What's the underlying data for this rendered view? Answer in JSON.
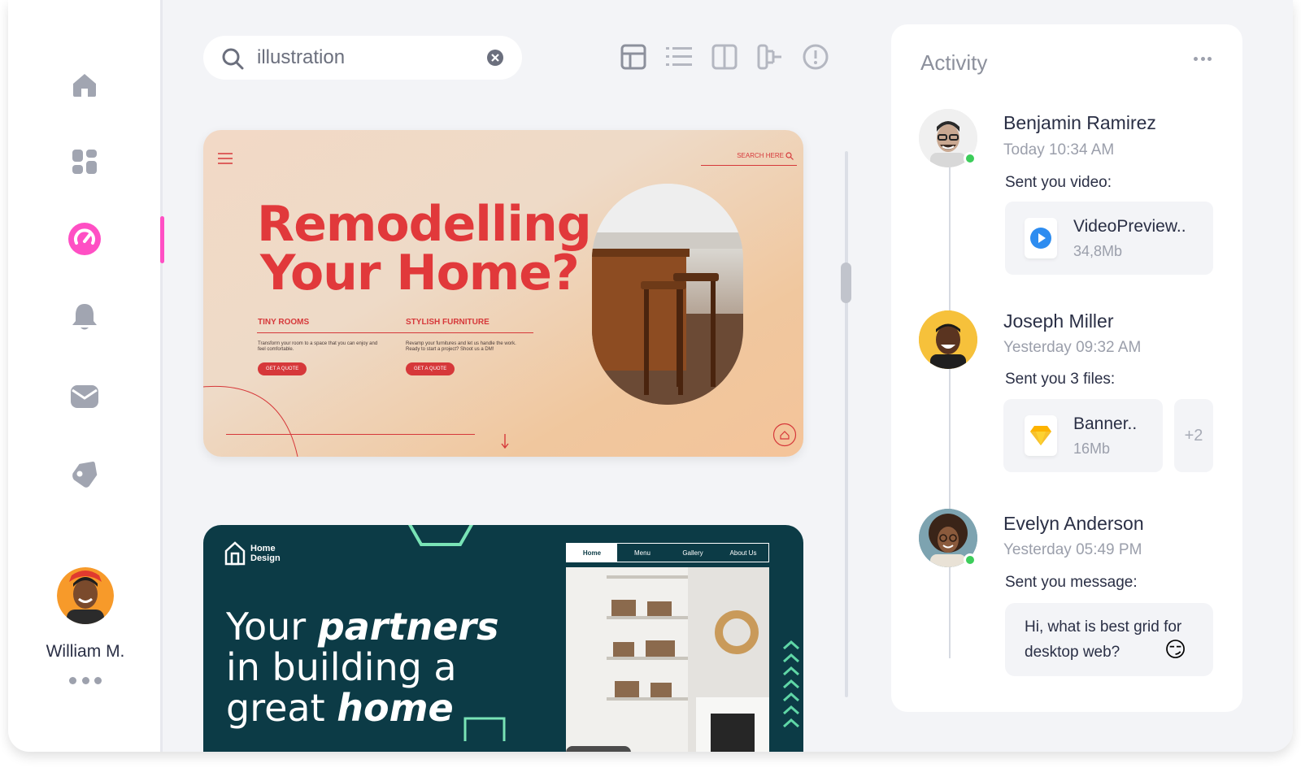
{
  "sidebar": {
    "items": [
      {
        "name": "home-icon"
      },
      {
        "name": "dashboard-icon"
      },
      {
        "name": "speed-gauge-icon",
        "active": true
      },
      {
        "name": "bell-icon"
      },
      {
        "name": "mail-icon"
      },
      {
        "name": "tag-icon"
      }
    ],
    "user": {
      "name": "William M."
    }
  },
  "search": {
    "value": "illustration"
  },
  "view_icons": [
    "grid-view-icon",
    "list-view-icon",
    "split-view-icon",
    "flow-view-icon",
    "info-icon"
  ],
  "cards": {
    "card1": {
      "title_line1": "Remodelling",
      "title_line2": "Your Home?",
      "search_label": "SEARCH HERE",
      "col1_heading": "TINY ROOMS",
      "col1_text": "Transform your room to a space that you can enjoy and feel comfortable.",
      "col1_button": "GET A QUOTE",
      "col2_heading": "STYLISH FURNITURE",
      "col2_text": "Revamp your furnitures and let us handle the work. Ready to start a project? Shoot us a DM!",
      "col2_button": "GET A QUOTE"
    },
    "card2": {
      "logo_line1": "Home",
      "logo_line2": "Design",
      "nav": [
        "Home",
        "Menu",
        "Gallery",
        "About Us"
      ],
      "title_word1": "Your",
      "title_word2": "partners",
      "title_line2": "in building a",
      "title_word3": "great",
      "title_word4": "home"
    }
  },
  "activity": {
    "title": "Activity",
    "entries": [
      {
        "name": "Benjamin Ramirez",
        "time": "Today 10:34 AM",
        "message": "Sent you video:",
        "online": true,
        "file": {
          "name": "VideoPreview..",
          "size": "34,8Mb",
          "icon": "play-icon"
        }
      },
      {
        "name": "Joseph Miller",
        "time": "Yesterday 09:32 AM",
        "message": "Sent you 3 files:",
        "online": false,
        "file": {
          "name": "Banner..",
          "size": "16Mb",
          "icon": "sketch-icon"
        },
        "extra": "+2"
      },
      {
        "name": "Evelyn Anderson",
        "time": "Yesterday 05:49 PM",
        "message": "Sent you message:",
        "online": true,
        "text": "Hi, what is best grid for desktop web?",
        "emoji": "😏"
      }
    ]
  },
  "colors": {
    "accent": "#ff4fc4",
    "online": "#3ccd5a",
    "card1_red": "#e1393b",
    "card2_bg": "#0c3b46"
  }
}
